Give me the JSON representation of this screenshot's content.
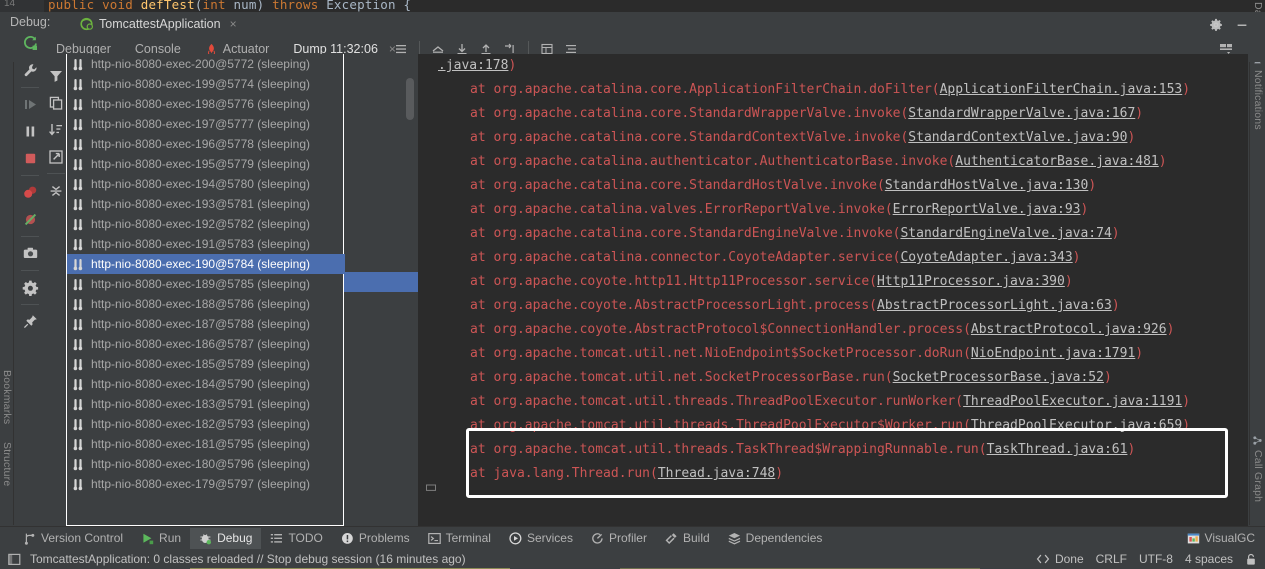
{
  "editor": {
    "code_line": "public void defTest(int num) throws Exception {"
  },
  "debug_window": {
    "label": "Debug:",
    "run_tab": {
      "title": "TomcattestApplication",
      "icon": "spring-boot-run-icon",
      "close": "×"
    },
    "header_buttons": [
      {
        "name": "settings-gear-icon",
        "glyph": "gear"
      },
      {
        "name": "minimize-icon",
        "glyph": "minus"
      }
    ],
    "tabs": [
      {
        "label": "Debugger",
        "icon": "",
        "active": false,
        "closable": false
      },
      {
        "label": "Console",
        "icon": "",
        "active": false,
        "closable": false
      },
      {
        "label": "Actuator",
        "icon": "actuator-icon",
        "active": false,
        "closable": false
      },
      {
        "label": "Dump 11:32:06",
        "icon": "",
        "active": true,
        "closable": true
      }
    ],
    "toolbar_icons": [
      "menu-lines-icon",
      "restore-layout-icon",
      "export-down-icon",
      "import-up-icon",
      "jump-to-end-icon",
      "table-view-icon",
      "soft-wrap-icon"
    ],
    "toolbar_right_icon": "layout-settings-icon",
    "side_icons_primary": [
      "rerun-debug-icon",
      "wrench-settings-icon",
      "resume-program-icon",
      "pause-program-icon",
      "stop-program-icon",
      "view-breakpoints-icon",
      "mute-breakpoints-icon",
      "camera-snapshot-icon",
      "settings-gear-icon",
      "pin-tab-icon"
    ],
    "side_icons_secondary": [
      "filter-icon",
      "copy-icon",
      "sort-icon",
      "export-icon",
      "collapse-icon"
    ]
  },
  "threads": {
    "selected_index": 10,
    "items": [
      {
        "name": "http-nio-8080-exec-200@5772",
        "state": "(sleeping)"
      },
      {
        "name": "http-nio-8080-exec-199@5774",
        "state": "(sleeping)"
      },
      {
        "name": "http-nio-8080-exec-198@5776",
        "state": "(sleeping)"
      },
      {
        "name": "http-nio-8080-exec-197@5777",
        "state": "(sleeping)"
      },
      {
        "name": "http-nio-8080-exec-196@5778",
        "state": "(sleeping)"
      },
      {
        "name": "http-nio-8080-exec-195@5779",
        "state": "(sleeping)"
      },
      {
        "name": "http-nio-8080-exec-194@5780",
        "state": "(sleeping)"
      },
      {
        "name": "http-nio-8080-exec-193@5781",
        "state": "(sleeping)"
      },
      {
        "name": "http-nio-8080-exec-192@5782",
        "state": "(sleeping)"
      },
      {
        "name": "http-nio-8080-exec-191@5783",
        "state": "(sleeping)"
      },
      {
        "name": "http-nio-8080-exec-190@5784",
        "state": "(sleeping)"
      },
      {
        "name": "http-nio-8080-exec-189@5785",
        "state": "(sleeping)"
      },
      {
        "name": "http-nio-8080-exec-188@5786",
        "state": "(sleeping)"
      },
      {
        "name": "http-nio-8080-exec-187@5788",
        "state": "(sleeping)"
      },
      {
        "name": "http-nio-8080-exec-186@5787",
        "state": "(sleeping)"
      },
      {
        "name": "http-nio-8080-exec-185@5789",
        "state": "(sleeping)"
      },
      {
        "name": "http-nio-8080-exec-184@5790",
        "state": "(sleeping)"
      },
      {
        "name": "http-nio-8080-exec-183@5791",
        "state": "(sleeping)"
      },
      {
        "name": "http-nio-8080-exec-182@5793",
        "state": "(sleeping)"
      },
      {
        "name": "http-nio-8080-exec-181@5795",
        "state": "(sleeping)"
      },
      {
        "name": "http-nio-8080-exec-180@5796",
        "state": "(sleeping)"
      },
      {
        "name": "http-nio-8080-exec-179@5797",
        "state": "(sleeping)"
      }
    ]
  },
  "stack_trace": {
    "lines": [
      {
        "prefix": ".java:178)",
        "link": "",
        "suffix": "",
        "first": true,
        "highlighted": false
      },
      {
        "prefix": "at org.apache.catalina.core.ApplicationFilterChain.doFilter(",
        "link": "ApplicationFilterChain.java:153",
        "suffix": ")",
        "first": false,
        "highlighted": false
      },
      {
        "prefix": "at org.apache.catalina.core.StandardWrapperValve.invoke(",
        "link": "StandardWrapperValve.java:167",
        "suffix": ")",
        "first": false,
        "highlighted": false
      },
      {
        "prefix": "at org.apache.catalina.core.StandardContextValve.invoke(",
        "link": "StandardContextValve.java:90",
        "suffix": ")",
        "first": false,
        "highlighted": false
      },
      {
        "prefix": "at org.apache.catalina.authenticator.AuthenticatorBase.invoke(",
        "link": "AuthenticatorBase.java:481",
        "suffix": ")",
        "first": false,
        "highlighted": false
      },
      {
        "prefix": "at org.apache.catalina.core.StandardHostValve.invoke(",
        "link": "StandardHostValve.java:130",
        "suffix": ")",
        "first": false,
        "highlighted": false
      },
      {
        "prefix": "at org.apache.catalina.valves.ErrorReportValve.invoke(",
        "link": "ErrorReportValve.java:93",
        "suffix": ")",
        "first": false,
        "highlighted": false
      },
      {
        "prefix": "at org.apache.catalina.core.StandardEngineValve.invoke(",
        "link": "StandardEngineValve.java:74",
        "suffix": ")",
        "first": false,
        "highlighted": false
      },
      {
        "prefix": "at org.apache.catalina.connector.CoyoteAdapter.service(",
        "link": "CoyoteAdapter.java:343",
        "suffix": ")",
        "first": false,
        "highlighted": false
      },
      {
        "prefix": "at org.apache.coyote.http11.Http11Processor.service(",
        "link": "Http11Processor.java:390",
        "suffix": ")",
        "first": false,
        "highlighted": false
      },
      {
        "prefix": "at org.apache.coyote.AbstractProcessorLight.process(",
        "link": "AbstractProcessorLight.java:63",
        "suffix": ")",
        "first": false,
        "highlighted": false
      },
      {
        "prefix": "at org.apache.coyote.AbstractProtocol$ConnectionHandler.process(",
        "link": "AbstractProtocol.java:926",
        "suffix": ")",
        "first": false,
        "highlighted": false
      },
      {
        "prefix": "at org.apache.tomcat.util.net.NioEndpoint$SocketProcessor.doRun(",
        "link": "NioEndpoint.java:1791",
        "suffix": ")",
        "first": false,
        "highlighted": false
      },
      {
        "prefix": "at org.apache.tomcat.util.net.SocketProcessorBase.run(",
        "link": "SocketProcessorBase.java:52",
        "suffix": ")",
        "first": false,
        "highlighted": false
      },
      {
        "prefix": "at org.apache.tomcat.util.threads.ThreadPoolExecutor.runWorker(",
        "link": "ThreadPoolExecutor.java:1191",
        "suffix": ")",
        "first": false,
        "highlighted": true
      },
      {
        "prefix": "at org.apache.tomcat.util.threads.ThreadPoolExecutor$Worker.run(",
        "link": "ThreadPoolExecutor.java:659",
        "suffix": ")",
        "first": false,
        "highlighted": true
      },
      {
        "prefix": "at org.apache.tomcat.util.threads.TaskThread$WrappingRunnable.run(",
        "link": "TaskThread.java:61",
        "suffix": ")",
        "first": false,
        "highlighted": true
      },
      {
        "prefix": "at java.lang.Thread.run(",
        "link": "Thread.java:748",
        "suffix": ")",
        "first": false,
        "highlighted": false
      }
    ]
  },
  "left_strip": [
    {
      "label": "Bookmarks",
      "name": "sidebar-item-bookmarks"
    },
    {
      "label": "Structure",
      "name": "sidebar-item-structure"
    }
  ],
  "right_strip": [
    {
      "label": "Database",
      "name": "sidebar-item-database"
    },
    {
      "label": "Notifications",
      "name": "sidebar-item-notifications"
    },
    {
      "label": "Call Graph",
      "name": "sidebar-item-call-graph"
    }
  ],
  "tool_window_bar": {
    "items": [
      {
        "label": "Version Control",
        "icon": "branch-icon",
        "active": false
      },
      {
        "label": "Run",
        "icon": "run-icon",
        "active": false
      },
      {
        "label": "Debug",
        "icon": "debug-icon",
        "active": true
      },
      {
        "label": "TODO",
        "icon": "todo-icon",
        "active": false
      },
      {
        "label": "Problems",
        "icon": "problems-icon",
        "active": false
      },
      {
        "label": "Terminal",
        "icon": "terminal-icon",
        "active": false
      },
      {
        "label": "Services",
        "icon": "services-icon",
        "active": false
      },
      {
        "label": "Profiler",
        "icon": "profiler-icon",
        "active": false
      },
      {
        "label": "Build",
        "icon": "build-hammer-icon",
        "active": false
      },
      {
        "label": "Dependencies",
        "icon": "dependencies-icon",
        "active": false
      }
    ],
    "right": {
      "label": "VisualGC",
      "icon": "visualgc-icon"
    }
  },
  "status_bar": {
    "message": "TomcattestApplication: 0 classes reloaded // Stop debug session (16 minutes ago)",
    "right_items": [
      {
        "label": "Done",
        "name": "status-done",
        "icon": "code-brackets-icon"
      },
      {
        "label": "CRLF",
        "name": "status-line-separator",
        "icon": ""
      },
      {
        "label": "UTF-8",
        "name": "status-encoding",
        "icon": ""
      },
      {
        "label": "4 spaces",
        "name": "status-indent",
        "icon": ""
      }
    ],
    "lock_icon": "lock-icon"
  },
  "colors": {
    "accent": "#4a88c7",
    "selection": "#4b6eaf",
    "stack_text": "#cc5555",
    "panel_bg": "#3c3f41",
    "editor_bg": "#2b2b2b"
  }
}
